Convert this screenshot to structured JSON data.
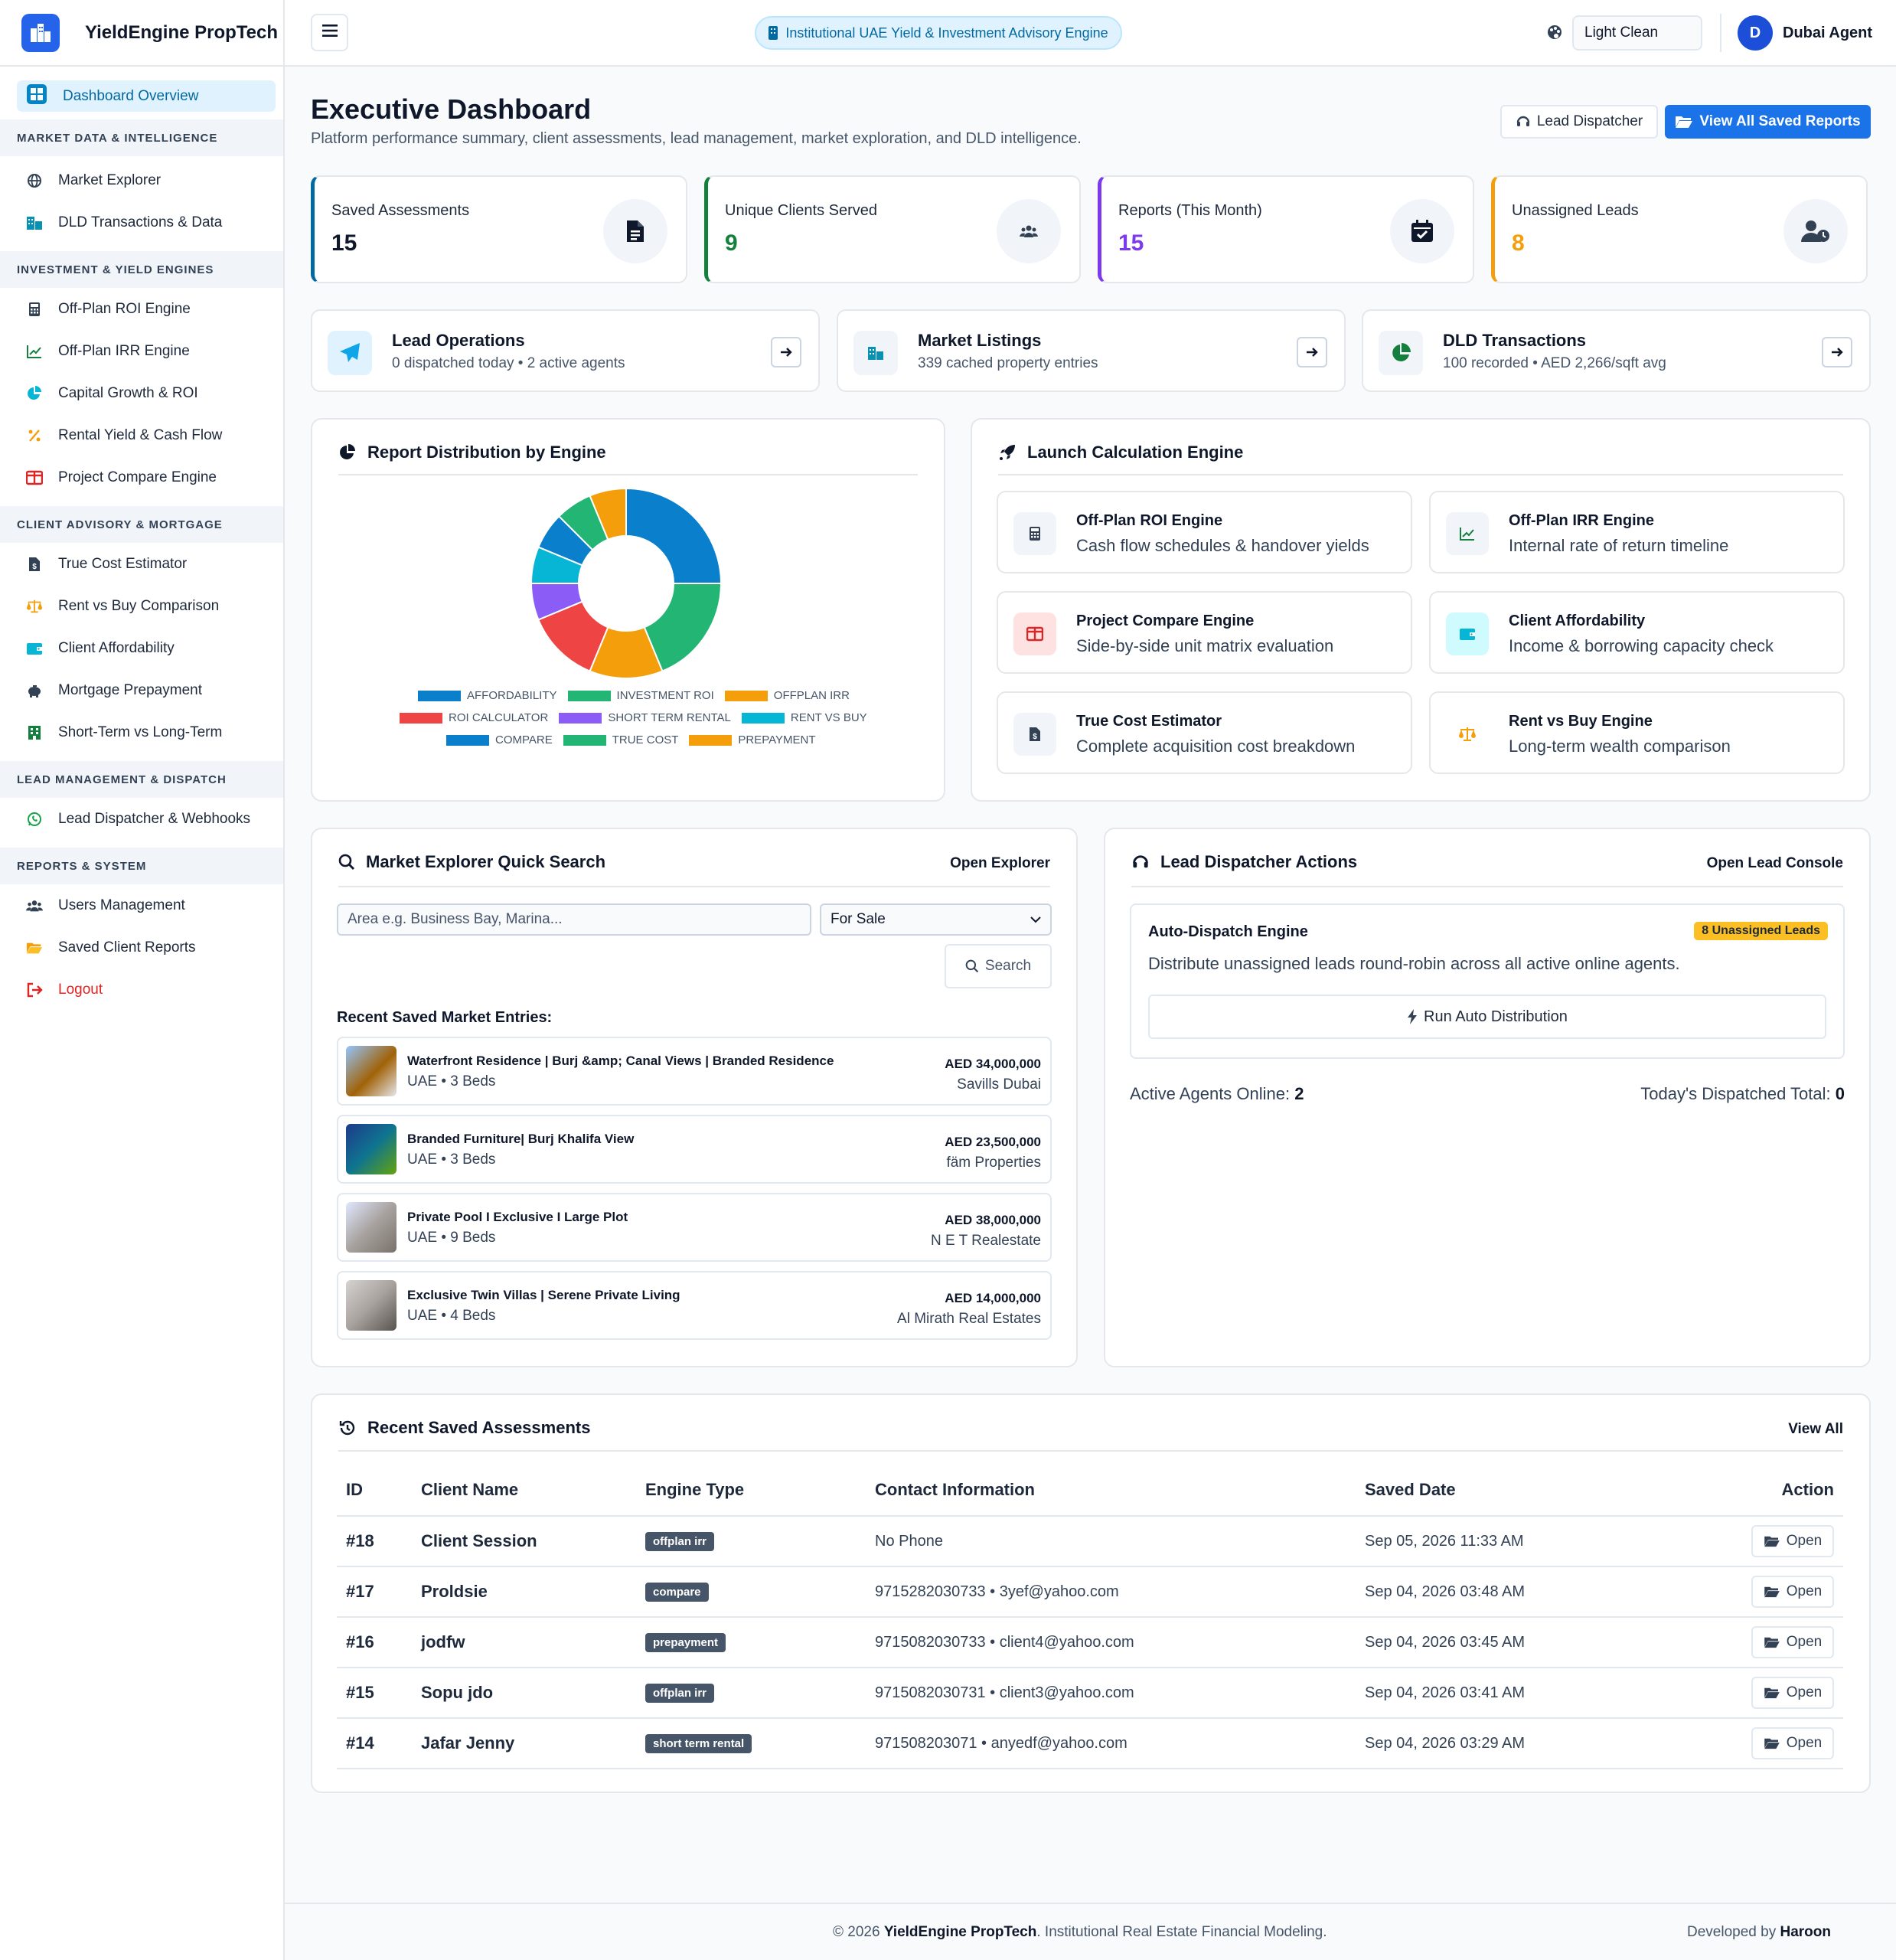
{
  "brand": {
    "name": "YieldEngine PropTech"
  },
  "sidebar": {
    "active": {
      "label": "Dashboard Overview",
      "icon": "dashboard-icon"
    },
    "sections": [
      {
        "title": "MARKET DATA & INTELLIGENCE",
        "items": [
          {
            "label": "Market Explorer",
            "icon": "globe-icon"
          },
          {
            "label": "DLD Transactions & Data",
            "icon": "building-icon"
          }
        ]
      },
      {
        "title": "INVESTMENT & YIELD ENGINES",
        "items": [
          {
            "label": "Off-Plan ROI Engine",
            "icon": "calculator-icon"
          },
          {
            "label": "Off-Plan IRR Engine",
            "icon": "chart-line-icon"
          },
          {
            "label": "Capital Growth & ROI",
            "icon": "pie-icon"
          },
          {
            "label": "Rental Yield & Cash Flow",
            "icon": "percent-icon"
          },
          {
            "label": "Project Compare Engine",
            "icon": "columns-icon"
          }
        ]
      },
      {
        "title": "CLIENT ADVISORY & MORTGAGE",
        "items": [
          {
            "label": "True Cost Estimator",
            "icon": "invoice-icon"
          },
          {
            "label": "Rent vs Buy Comparison",
            "icon": "scale-icon"
          },
          {
            "label": "Client Affordability",
            "icon": "wallet-icon"
          },
          {
            "label": "Mortgage Prepayment",
            "icon": "piggy-bank-icon"
          },
          {
            "label": "Short-Term vs Long-Term",
            "icon": "hotel-icon"
          }
        ]
      },
      {
        "title": "LEAD MANAGEMENT & DISPATCH",
        "items": [
          {
            "label": "Lead Dispatcher & Webhooks",
            "icon": "whatsapp-icon"
          }
        ]
      },
      {
        "title": "REPORTS & SYSTEM",
        "items": [
          {
            "label": "Users Management",
            "icon": "users-icon"
          },
          {
            "label": "Saved Client Reports",
            "icon": "folder-icon"
          },
          {
            "label": "Logout",
            "icon": "logout-icon"
          }
        ]
      }
    ]
  },
  "topbar": {
    "engine_pill": "Institutional UAE Yield & Investment Advisory Engine",
    "theme_value": "Light Clean",
    "user_initial": "D",
    "user_name": "Dubai Agent"
  },
  "header": {
    "title": "Executive Dashboard",
    "subtitle": "Platform performance summary, client assessments, lead management, market exploration, and DLD intelligence.",
    "lead_dispatcher_btn": "Lead Dispatcher",
    "view_reports_btn": "View All Saved Reports"
  },
  "stats": [
    {
      "title": "Saved Assessments",
      "value": "15",
      "color": "#0369a1",
      "icon": "document-icon"
    },
    {
      "title": "Unique Clients Served",
      "value": "9",
      "color": "#15803d",
      "icon": "users-icon"
    },
    {
      "title": "Reports (This Month)",
      "value": "15",
      "color": "#7c3aed",
      "icon": "calendar-check-icon"
    },
    {
      "title": "Unassigned Leads",
      "value": "8",
      "color": "#f59e0b",
      "icon": "user-clock-icon"
    }
  ],
  "quick_links": [
    {
      "title": "Lead Operations",
      "desc": "0 dispatched today • 2 active agents",
      "icon": "paper-plane-icon"
    },
    {
      "title": "Market Listings",
      "desc": "339 cached property entries",
      "icon": "building-icon"
    },
    {
      "title": "DLD Transactions",
      "desc": "100 recorded • AED 2,266/sqft avg",
      "icon": "pie-chart-icon"
    }
  ],
  "distribution": {
    "title": "Report Distribution by Engine"
  },
  "chart_data": {
    "type": "pie",
    "variant": "doughnut",
    "categories": [
      "AFFORDABILITY",
      "INVESTMENT ROI",
      "OFFPLAN IRR",
      "ROI CALCULATOR",
      "SHORT TERM RENTAL",
      "RENT VS BUY",
      "COMPARE",
      "TRUE COST",
      "PREPAYMENT"
    ],
    "values": [
      4,
      3,
      2,
      2,
      1,
      1,
      1,
      1,
      1
    ],
    "colors": [
      "#0a7fcb",
      "#22b573",
      "#f59e0b",
      "#ef4444",
      "#8b5cf6",
      "#06b6d4",
      "#0a7fcb",
      "#22b573",
      "#f59e0b"
    ],
    "legend": "bottom"
  },
  "launch": {
    "title": "Launch Calculation Engine",
    "engines": [
      {
        "title": "Off-Plan ROI Engine",
        "desc": "Cash flow schedules & handover yields",
        "icon": "calculator-icon"
      },
      {
        "title": "Off-Plan IRR Engine",
        "desc": "Internal rate of return timeline",
        "icon": "chart-line-icon"
      },
      {
        "title": "Project Compare Engine",
        "desc": "Side-by-side unit matrix evaluation",
        "icon": "columns-icon"
      },
      {
        "title": "Client Affordability",
        "desc": "Income & borrowing capacity check",
        "icon": "wallet-icon"
      },
      {
        "title": "True Cost Estimator",
        "desc": "Complete acquisition cost breakdown",
        "icon": "invoice-icon"
      },
      {
        "title": "Rent vs Buy Engine",
        "desc": "Long-term wealth comparison",
        "icon": "scale-icon"
      }
    ]
  },
  "market_search": {
    "title": "Market Explorer Quick Search",
    "link": "Open Explorer",
    "placeholder": "Area e.g. Business Bay, Marina...",
    "select_value": "For Sale",
    "search_btn": "Search",
    "recent_label": "Recent Saved Market Entries:",
    "entries": [
      {
        "name": "Waterfront Residence | Burj &amp; Canal Views | Branded Residence",
        "loc": "UAE • 3 Beds",
        "price": "AED 34,000,000",
        "agency": "Savills Dubai"
      },
      {
        "name": "Branded Furniture| Burj Khalifa View",
        "loc": "UAE • 3 Beds",
        "price": "AED 23,500,000",
        "agency": "fäm Properties"
      },
      {
        "name": "Private Pool I Exclusive I Large Plot",
        "loc": "UAE • 9 Beds",
        "price": "AED 38,000,000",
        "agency": "N E T Realestate"
      },
      {
        "name": "Exclusive Twin Villas | Serene Private Living",
        "loc": "UAE • 4 Beds",
        "price": "AED 14,000,000",
        "agency": "Al Mirath Real Estates"
      }
    ]
  },
  "dispatcher": {
    "title": "Lead Dispatcher Actions",
    "link": "Open Lead Console",
    "box_title": "Auto-Dispatch Engine",
    "badge": "8 Unassigned Leads",
    "desc": "Distribute unassigned leads round-robin across all active online agents.",
    "run_btn": "Run Auto Distribution",
    "agents_label": "Active Agents Online:",
    "agents_value": "2",
    "dispatched_label": "Today's Dispatched Total:",
    "dispatched_value": "0"
  },
  "assessments": {
    "title": "Recent Saved Assessments",
    "link": "View All",
    "columns": [
      "ID",
      "Client Name",
      "Engine Type",
      "Contact Information",
      "Saved Date",
      "Action"
    ],
    "open_label": "Open",
    "rows": [
      {
        "id": "#18",
        "client": "Client Session",
        "engine": "offplan irr",
        "contact": "No Phone",
        "date": "Sep 05, 2026 11:33 AM"
      },
      {
        "id": "#17",
        "client": "Proldsie",
        "engine": "compare",
        "contact": "9715282030733 • 3yef@yahoo.com",
        "date": "Sep 04, 2026 03:48 AM"
      },
      {
        "id": "#16",
        "client": "jodfw",
        "engine": "prepayment",
        "contact": "9715082030733 • client4@yahoo.com",
        "date": "Sep 04, 2026 03:45 AM"
      },
      {
        "id": "#15",
        "client": "Sopu jdo",
        "engine": "offplan irr",
        "contact": "9715082030731 • client3@yahoo.com",
        "date": "Sep 04, 2026 03:41 AM"
      },
      {
        "id": "#14",
        "client": "Jafar Jenny",
        "engine": "short term rental",
        "contact": "971508203071 • anyedf@yahoo.com",
        "date": "Sep 04, 2026 03:29 AM"
      }
    ]
  },
  "footer": {
    "prefix": "© 2026",
    "brand": "YieldEngine PropTech",
    "suffix": ". Institutional Real Estate Financial Modeling.",
    "dev_label": "Developed by",
    "dev_name": "Haroon"
  },
  "colors": {
    "accent": "#1a73e8",
    "sidebar_active_bg": "#e0f2fe"
  }
}
